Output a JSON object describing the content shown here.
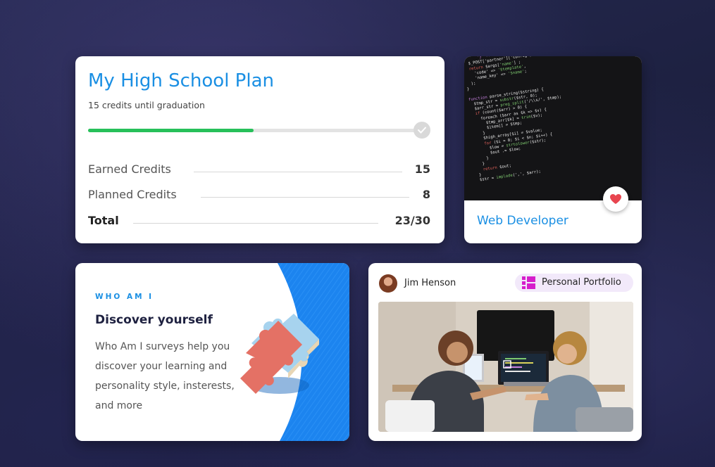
{
  "plan_card": {
    "title": "My High School Plan",
    "subtitle": "15 credits until graduation",
    "progress_fraction": 0.5,
    "rows": [
      {
        "label": "Earned Credits",
        "value": "15"
      },
      {
        "label": "Planned Credits",
        "value": "8"
      },
      {
        "label": "Total",
        "value": "23/30"
      }
    ]
  },
  "career_card": {
    "label": "Web Developer",
    "favorite_icon": "heart-icon"
  },
  "whoami_card": {
    "eyebrow": "WHO AM I",
    "heading": "Discover yourself",
    "body": "Who Am I surveys help you discover your learning and personality style, insterests, and more",
    "illustration": "puzzle-piece-icon"
  },
  "portfolio_card": {
    "user_name": "Jim Henson",
    "tag_label": "Personal Portfolio",
    "tag_icon": "portfolio-icon"
  },
  "colors": {
    "accent_blue": "#1a8fe3",
    "progress_green": "#27c05a",
    "heart_red": "#e8454f",
    "portfolio_magenta": "#d61ecb"
  }
}
